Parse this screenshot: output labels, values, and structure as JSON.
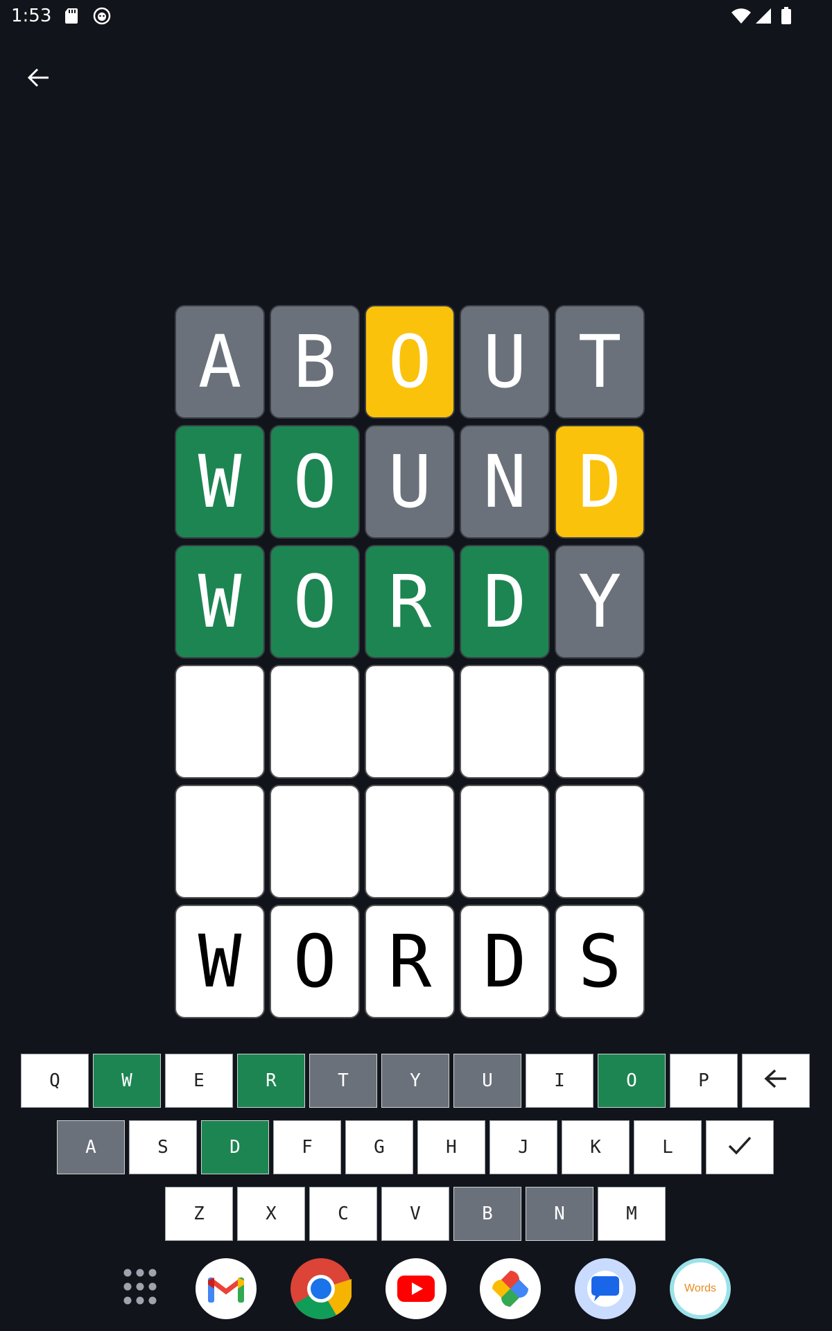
{
  "status_bar": {
    "time": "1:53",
    "icons": [
      "sd-card-icon",
      "cat-face-icon",
      "wifi-icon",
      "signal-icon",
      "battery-icon"
    ]
  },
  "nav": {
    "back_icon": "arrow-left-icon"
  },
  "board": {
    "rows": [
      [
        {
          "letter": "A",
          "state": "gray"
        },
        {
          "letter": "B",
          "state": "gray"
        },
        {
          "letter": "O",
          "state": "yellow"
        },
        {
          "letter": "U",
          "state": "gray"
        },
        {
          "letter": "T",
          "state": "gray"
        }
      ],
      [
        {
          "letter": "W",
          "state": "green"
        },
        {
          "letter": "O",
          "state": "green"
        },
        {
          "letter": "U",
          "state": "gray"
        },
        {
          "letter": "N",
          "state": "gray"
        },
        {
          "letter": "D",
          "state": "yellow"
        }
      ],
      [
        {
          "letter": "W",
          "state": "green"
        },
        {
          "letter": "O",
          "state": "green"
        },
        {
          "letter": "R",
          "state": "green"
        },
        {
          "letter": "D",
          "state": "green"
        },
        {
          "letter": "Y",
          "state": "gray"
        }
      ],
      [
        {
          "letter": "",
          "state": "empty"
        },
        {
          "letter": "",
          "state": "empty"
        },
        {
          "letter": "",
          "state": "empty"
        },
        {
          "letter": "",
          "state": "empty"
        },
        {
          "letter": "",
          "state": "empty"
        }
      ],
      [
        {
          "letter": "",
          "state": "empty"
        },
        {
          "letter": "",
          "state": "empty"
        },
        {
          "letter": "",
          "state": "empty"
        },
        {
          "letter": "",
          "state": "empty"
        },
        {
          "letter": "",
          "state": "empty"
        }
      ],
      [
        {
          "letter": "W",
          "state": "empty"
        },
        {
          "letter": "O",
          "state": "empty"
        },
        {
          "letter": "R",
          "state": "empty"
        },
        {
          "letter": "D",
          "state": "empty"
        },
        {
          "letter": "S",
          "state": "empty"
        }
      ]
    ]
  },
  "keyboard": {
    "rows": [
      [
        {
          "label": "Q",
          "state": "default"
        },
        {
          "label": "W",
          "state": "green"
        },
        {
          "label": "E",
          "state": "default"
        },
        {
          "label": "R",
          "state": "green"
        },
        {
          "label": "T",
          "state": "gray"
        },
        {
          "label": "Y",
          "state": "gray"
        },
        {
          "label": "U",
          "state": "gray"
        },
        {
          "label": "I",
          "state": "default"
        },
        {
          "label": "O",
          "state": "green"
        },
        {
          "label": "P",
          "state": "default"
        },
        {
          "label": "",
          "icon": "backspace-arrow-icon",
          "state": "default"
        }
      ],
      [
        {
          "label": "A",
          "state": "gray"
        },
        {
          "label": "S",
          "state": "default"
        },
        {
          "label": "D",
          "state": "green"
        },
        {
          "label": "F",
          "state": "default"
        },
        {
          "label": "G",
          "state": "default"
        },
        {
          "label": "H",
          "state": "default"
        },
        {
          "label": "J",
          "state": "default"
        },
        {
          "label": "K",
          "state": "default"
        },
        {
          "label": "L",
          "state": "default"
        },
        {
          "label": "",
          "icon": "checkmark-icon",
          "state": "default"
        }
      ],
      [
        {
          "label": "Z",
          "state": "default"
        },
        {
          "label": "X",
          "state": "default"
        },
        {
          "label": "C",
          "state": "default"
        },
        {
          "label": "V",
          "state": "default"
        },
        {
          "label": "B",
          "state": "gray"
        },
        {
          "label": "N",
          "state": "gray"
        },
        {
          "label": "M",
          "state": "default"
        }
      ]
    ]
  },
  "dock": {
    "items": [
      {
        "name": "app-drawer-icon"
      },
      {
        "name": "gmail-icon"
      },
      {
        "name": "chrome-icon"
      },
      {
        "name": "youtube-icon"
      },
      {
        "name": "photos-icon"
      },
      {
        "name": "messages-icon"
      },
      {
        "name": "words-app-icon",
        "label": "Words"
      }
    ]
  },
  "colors": {
    "background": "#12141b",
    "green": "#1d8552",
    "yellow": "#fbc20b",
    "gray": "#6b717a"
  }
}
